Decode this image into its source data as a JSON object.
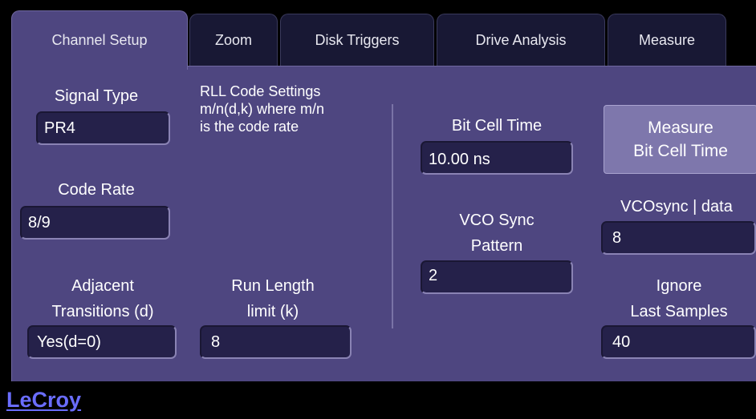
{
  "tabs": [
    {
      "label": "Channel Setup",
      "active": true
    },
    {
      "label": "Zoom",
      "active": false
    },
    {
      "label": "Disk Triggers",
      "active": false
    },
    {
      "label": "Drive Analysis",
      "active": false
    },
    {
      "label": "Measure",
      "active": false
    }
  ],
  "signal_type": {
    "label": "Signal Type",
    "value": "PR4"
  },
  "code_rate": {
    "label": "Code Rate",
    "value": "8/9"
  },
  "adjacent_transitions": {
    "label_line1": "Adjacent",
    "label_line2": "Transitions (d)",
    "value": "Yes(d=0)"
  },
  "rll_info": {
    "line1": "RLL Code Settings",
    "line2": "m/n(d,k) where m/n",
    "line3": "is the code rate"
  },
  "run_length": {
    "label_line1": "Run Length",
    "label_line2": "limit (k)",
    "value": "8"
  },
  "bit_cell_time": {
    "label": "Bit Cell Time",
    "value": "10.00 ns"
  },
  "vco_sync_pattern": {
    "label_line1": "VCO Sync",
    "label_line2": "Pattern",
    "value": "2"
  },
  "measure_button": {
    "line1": "Measure",
    "line2": "Bit Cell Time"
  },
  "vcosync_data": {
    "label": "VCOsync | data",
    "value": "8"
  },
  "ignore_last_samples": {
    "label_line1": "Ignore",
    "label_line2": "Last Samples",
    "value": "40"
  },
  "brand": {
    "logo_text": "LeCroy"
  },
  "colors": {
    "panel": "#4e4680",
    "field": "#25214a",
    "button": "#7e77ac",
    "logo": "#6a6dff",
    "background": "#000000"
  }
}
